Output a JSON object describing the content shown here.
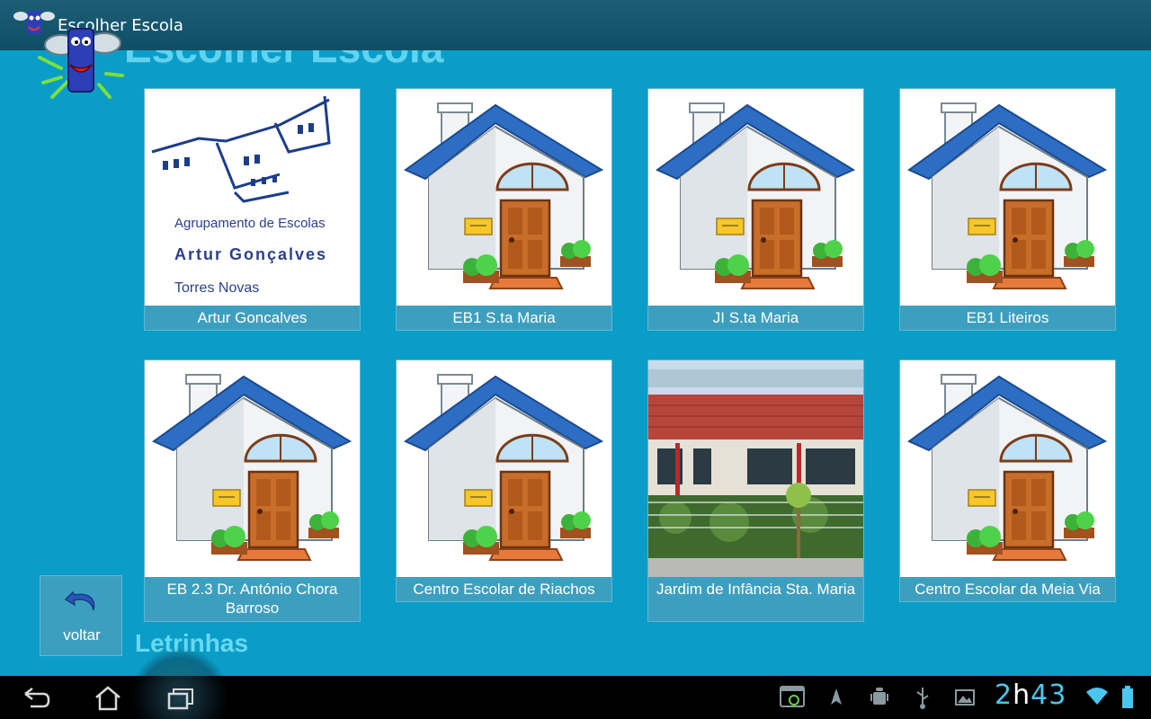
{
  "actionbar": {
    "title": "Escolher Escola",
    "app_icon": "letrinhas-logo-icon"
  },
  "header": {
    "title": "Escolher Escola"
  },
  "schools": [
    {
      "name": "Artur Goncalves",
      "image": "agrupamento-logo",
      "logo_text": [
        "Agrupamento de Escolas",
        "Artur Gonçalves",
        "Torres Novas"
      ]
    },
    {
      "name": "EB1 S.ta Maria",
      "image": "school-house-icon"
    },
    {
      "name": "JI S.ta Maria",
      "image": "school-house-icon"
    },
    {
      "name": "EB1 Liteiros",
      "image": "school-house-icon"
    },
    {
      "name": "EB 2.3 Dr. António Chora Barroso",
      "image": "school-house-icon"
    },
    {
      "name": "Centro Escolar de Riachos",
      "image": "school-house-icon"
    },
    {
      "name": "Jardim de Infância Sta. Maria",
      "image": "school-building-photo"
    },
    {
      "name": "Centro Escolar da Meia Via",
      "image": "school-house-icon"
    }
  ],
  "back_button": {
    "label": "voltar",
    "icon": "undo-arrow-icon"
  },
  "footer": {
    "brand": "Letrinhas"
  },
  "system_bar": {
    "nav_icons": [
      "back-icon",
      "home-icon",
      "recent-apps-icon"
    ],
    "status_icons": [
      "screenshot-icon",
      "navigation-icon",
      "android-debug-icon",
      "usb-icon",
      "gallery-icon",
      "wifi-icon",
      "battery-icon"
    ],
    "clock_hours": "2",
    "clock_sep": "h",
    "clock_minutes": "43"
  },
  "colors": {
    "background": "#0a9dc8",
    "actionbar": "#15566d",
    "caption_bg": "#3d9fbf",
    "title_text": "#5fd3f0",
    "clock_accent": "#4bc6ee"
  }
}
